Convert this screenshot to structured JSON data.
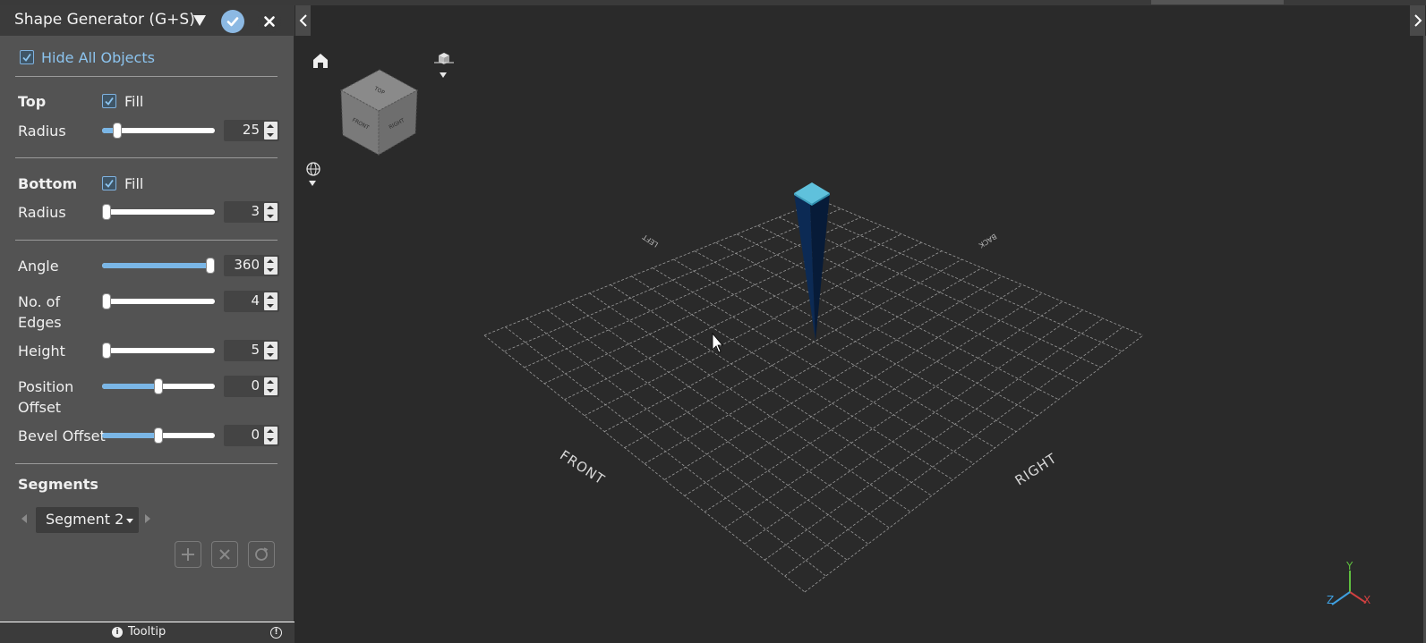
{
  "panel": {
    "title": "Shape Generator (G+S)",
    "hide_all_label": "Hide All Objects",
    "hide_all_checked": true,
    "top": {
      "heading": "Top",
      "fill_label": "Fill",
      "fill_checked": true,
      "radius_label": "Radius",
      "radius_value": "25",
      "radius_slider_fraction": 0.1
    },
    "bottom": {
      "heading": "Bottom",
      "fill_label": "Fill",
      "fill_checked": true,
      "radius_label": "Radius",
      "radius_value": "3",
      "radius_slider_fraction": 0.0
    },
    "params": [
      {
        "label": "Angle",
        "value": "360",
        "slider_fraction": 1.0
      },
      {
        "label": "No. of Edges",
        "value": "4",
        "slider_fraction": 0.0
      },
      {
        "label": "Height",
        "value": "5",
        "slider_fraction": 0.0
      },
      {
        "label": "Position Offset",
        "value": "0",
        "slider_fraction": 0.5
      },
      {
        "label": "Bevel Offset",
        "value": "0",
        "slider_fraction": 0.5
      }
    ],
    "segments": {
      "heading": "Segments",
      "selected": "Segment 2"
    },
    "tooltip_label": "Tooltip"
  },
  "viewport": {
    "cube_faces": {
      "top": "TOP",
      "front": "FRONT",
      "right": "RIGHT"
    },
    "grid_labels": {
      "front": "FRONT",
      "right": "RIGHT",
      "left": "LEFT",
      "back": "BACK"
    },
    "axes": {
      "x": "X",
      "y": "Y",
      "z": "Z"
    },
    "colors": {
      "shape_side": "#0b2447",
      "shape_top": "#5fc1dc",
      "axis_x": "#d04040",
      "axis_y": "#5fbf3f",
      "axis_z": "#3f9fdf"
    }
  }
}
